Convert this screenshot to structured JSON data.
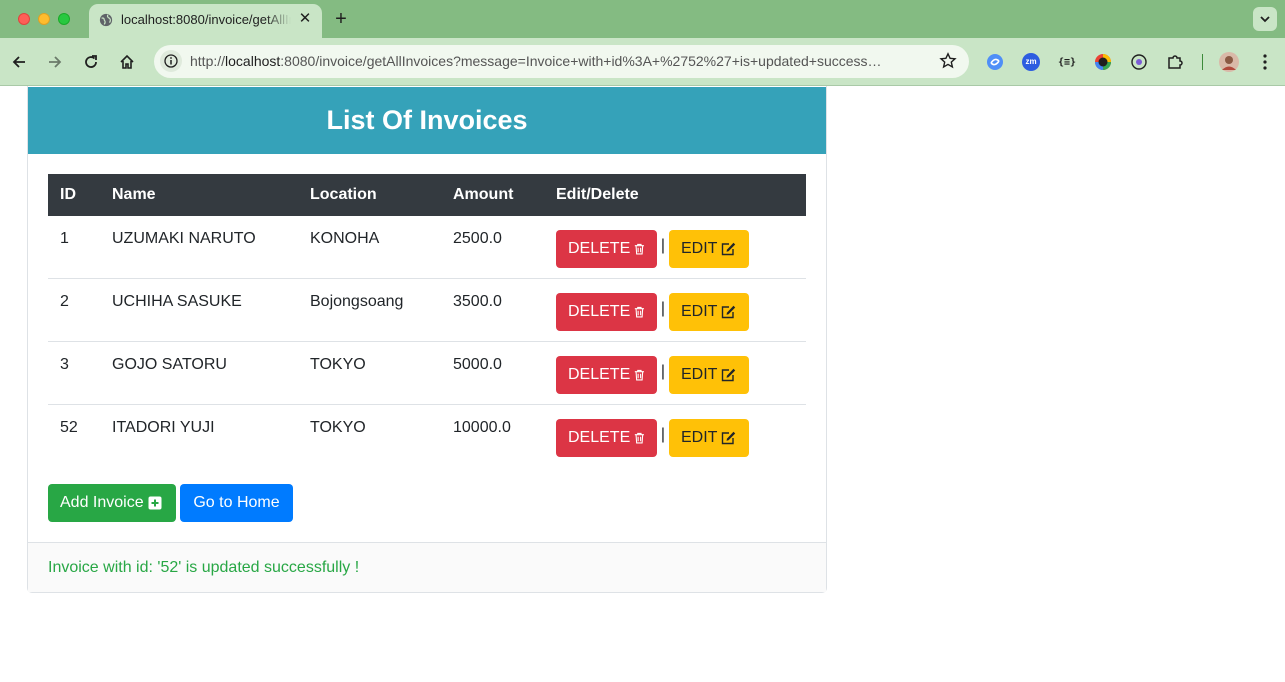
{
  "browser": {
    "tab_title": "localhost:8080/invoice/getAllInvoices",
    "tab_close": "✕",
    "new_tab": "+",
    "url_host": "localhost",
    "url_rest": ":8080/invoice/getAllInvoices?message=Invoice+with+id%3A+%2752%27+is+updated+success…",
    "ext_zm": "zm",
    "ext_json": "{≡}"
  },
  "page": {
    "title": "List Of Invoices",
    "table": {
      "headers": {
        "id": "ID",
        "name": "Name",
        "location": "Location",
        "amount": "Amount",
        "actions": "Edit/Delete"
      },
      "rows": [
        {
          "id": "1",
          "name": "UZUMAKI NARUTO",
          "location": "KONOHA",
          "amount": "2500.0"
        },
        {
          "id": "2",
          "name": "UCHIHA SASUKE",
          "location": "Bojongsoang",
          "amount": "3500.0"
        },
        {
          "id": "3",
          "name": "GOJO SATORU",
          "location": "TOKYO",
          "amount": "5000.0"
        },
        {
          "id": "52",
          "name": "ITADORI YUJI",
          "location": "TOKYO",
          "amount": "10000.0"
        }
      ],
      "delete_label": "DELETE",
      "edit_label": "EDIT",
      "separator": "|"
    },
    "add_invoice_label": "Add Invoice",
    "home_label": "Go to Home",
    "message": "Invoice with id: '52' is updated successfully !"
  },
  "colors": {
    "header_bg": "#35a2b9",
    "table_head": "#343a40",
    "danger": "#dc3545",
    "warning": "#ffc107",
    "success": "#28a745",
    "primary": "#007bff",
    "chrome_tabstrip": "#84bb82",
    "chrome_toolbar": "#c9e5c6"
  },
  "icons": [
    "globe-icon",
    "back-arrow-icon",
    "forward-arrow-icon",
    "reload-icon",
    "home-icon",
    "site-info-icon",
    "star-icon",
    "extension-puzzle-icon",
    "trash-icon",
    "edit-icon",
    "plus-square-icon"
  ]
}
